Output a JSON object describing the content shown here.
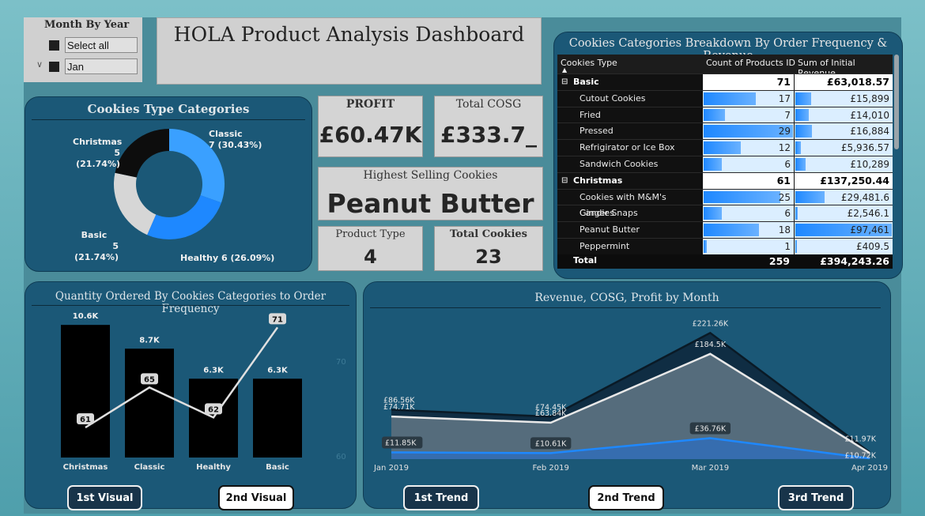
{
  "slicer": {
    "title": "Month By Year",
    "items": [
      {
        "label": "Select all"
      },
      {
        "label": "Jan"
      }
    ]
  },
  "dashboard_title": "HOLA Product Analysis Dashboard",
  "donut": {
    "title": "Cookies Type Categories",
    "labels": [
      {
        "name": "Classic",
        "value": "7 (30.43%)"
      },
      {
        "name": "Healthy",
        "value": "6 (26.09%)"
      },
      {
        "name": "Basic",
        "value": "5 (21.74%)"
      },
      {
        "name": "Christmas",
        "value": "5 (21.74%)"
      }
    ]
  },
  "kpis": {
    "profit": {
      "title": "PROFIT",
      "value": "£60.47K"
    },
    "cosg": {
      "title": "Total COSG",
      "value": "£333.7_"
    },
    "highest": {
      "title": "Highest Selling Cookies",
      "value": "Peanut Butter"
    },
    "product_type": {
      "title": "Product Type",
      "value": "4"
    },
    "total_cookies": {
      "title": "Total Cookies",
      "value": "23"
    }
  },
  "table": {
    "title": "Cookies Categories Breakdown By Order Frequency & Revenue",
    "headers": [
      "Cookies Type",
      "Count of Products ID",
      "Sum of Initial Revenue"
    ],
    "rows": [
      {
        "name": "Basic",
        "count": "71",
        "revenue": "£63,018.57",
        "cat": true,
        "icon": "⊟"
      },
      {
        "name": "Cutout Cookies",
        "count": "17",
        "revenue": "£15,899"
      },
      {
        "name": "Fried",
        "count": "7",
        "revenue": "£14,010"
      },
      {
        "name": "Pressed",
        "count": "29",
        "revenue": "£16,884"
      },
      {
        "name": "Refrigirator or Ice Box",
        "count": "12",
        "revenue": "£5,936.57"
      },
      {
        "name": "Sandwich Cookies",
        "count": "6",
        "revenue": "£10,289"
      },
      {
        "name": "Christmas",
        "count": "61",
        "revenue": "£137,250.44",
        "cat": true,
        "icon": "⊟"
      },
      {
        "name": "Cookies with M&M's Candies",
        "count": "25",
        "revenue": "£29,481.6"
      },
      {
        "name": "Ginger Snaps",
        "count": "6",
        "revenue": "£2,546.1"
      },
      {
        "name": "Peanut Butter",
        "count": "18",
        "revenue": "£97,461"
      },
      {
        "name": "Peppermint",
        "count": "1",
        "revenue": "£409.5"
      }
    ],
    "total": {
      "label": "Total",
      "count": "259",
      "revenue": "£394,243.26"
    }
  },
  "bar_chart": {
    "title": "Quantity Ordered By Cookies Categories to Order Frequency",
    "right_axis_ticks": [
      "70",
      "60"
    ]
  },
  "area_chart": {
    "title": "Revenue, COSG, Profit by Month"
  },
  "buttons": {
    "first_visual": "1st Visual",
    "second_visual": "2nd Visual",
    "first_trend": "1st Trend",
    "second_trend": "2nd Trend",
    "third_trend": "3rd Trend"
  },
  "chart_data": [
    {
      "type": "pie",
      "title": "Cookies Type Categories",
      "categories": [
        "Classic",
        "Healthy",
        "Basic",
        "Christmas"
      ],
      "values": [
        7,
        6,
        5,
        5
      ],
      "percent": [
        30.43,
        26.09,
        21.74,
        21.74
      ],
      "colors": [
        "#3aa0ff",
        "#1e88ff",
        "#d6d6d6",
        "#0d0d0d"
      ]
    },
    {
      "type": "bar",
      "title": "Quantity Ordered By Cookies Categories to Order Frequency",
      "categories": [
        "Christmas",
        "Classic",
        "Healthy",
        "Basic"
      ],
      "series": [
        {
          "type": "bar",
          "values": [
            10.6,
            8.7,
            6.3,
            6.3
          ],
          "labels": [
            "10.6K",
            "8.7K",
            "6.3K",
            "6.3K"
          ],
          "color": "#000000"
        },
        {
          "type": "line",
          "values": [
            61,
            65,
            62,
            71
          ],
          "labels": [
            "61",
            "65",
            "62",
            "71"
          ],
          "color": "#e0e0e0"
        }
      ]
    },
    {
      "type": "area",
      "title": "Revenue, COSG, Profit by Month",
      "x": [
        "Jan 2019",
        "Feb 2019",
        "Mar 2019",
        "Apr 2019"
      ],
      "series": [
        {
          "values": [
            86.56,
            74.45,
            221.26,
            11.97
          ],
          "labels": [
            "£86.56K",
            "£74.45K",
            "£221.26K",
            "£11.97K"
          ],
          "color": "#0f2a3d"
        },
        {
          "values": [
            74.71,
            63.84,
            184.5,
            10.72
          ],
          "labels": [
            "£74.71K",
            "£63.84K",
            "£184.5K",
            "£10.72K"
          ],
          "color": "#5f7a8a"
        },
        {
          "values": [
            11.85,
            10.61,
            36.76,
            1.25
          ],
          "labels": [
            "£11.85K",
            "£10.61K",
            "£36.76K",
            ""
          ],
          "color": "#1e88ff"
        }
      ]
    }
  ]
}
